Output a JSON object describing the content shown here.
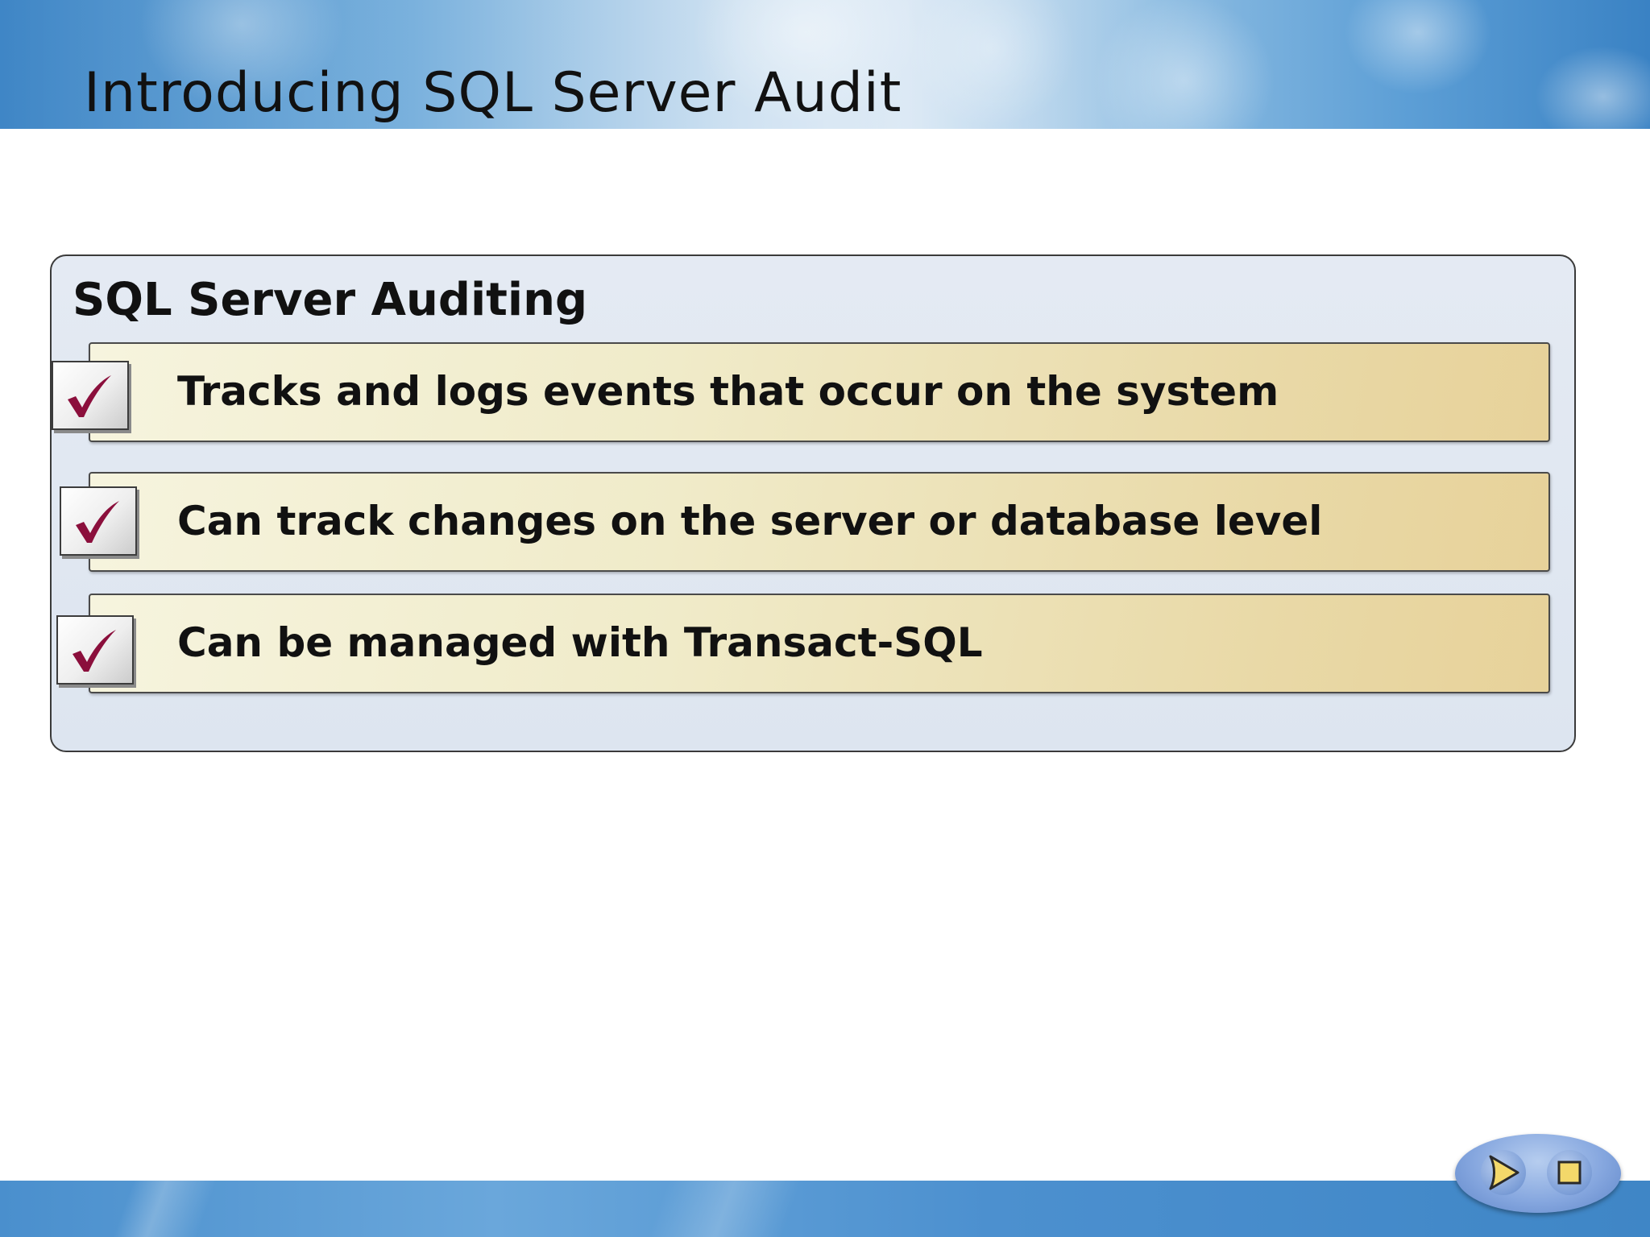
{
  "slide": {
    "title": "Introducing SQL Server Audit",
    "panel_heading": "SQL Server Auditing",
    "items": [
      {
        "text": "Tracks and logs events that occur on the system",
        "checked": true
      },
      {
        "text": "Can track changes on the server or database level",
        "checked": true
      },
      {
        "text": "Can be managed with Transact-SQL",
        "checked": true
      }
    ]
  },
  "controls": {
    "play_icon": "play-icon",
    "stop_icon": "stop-icon"
  },
  "colors": {
    "check_mark": "#8b0f3c",
    "header_blue": "#3f86c6",
    "bar_gold": "#e7d29a",
    "panel_bg": "#e2e8f1"
  }
}
